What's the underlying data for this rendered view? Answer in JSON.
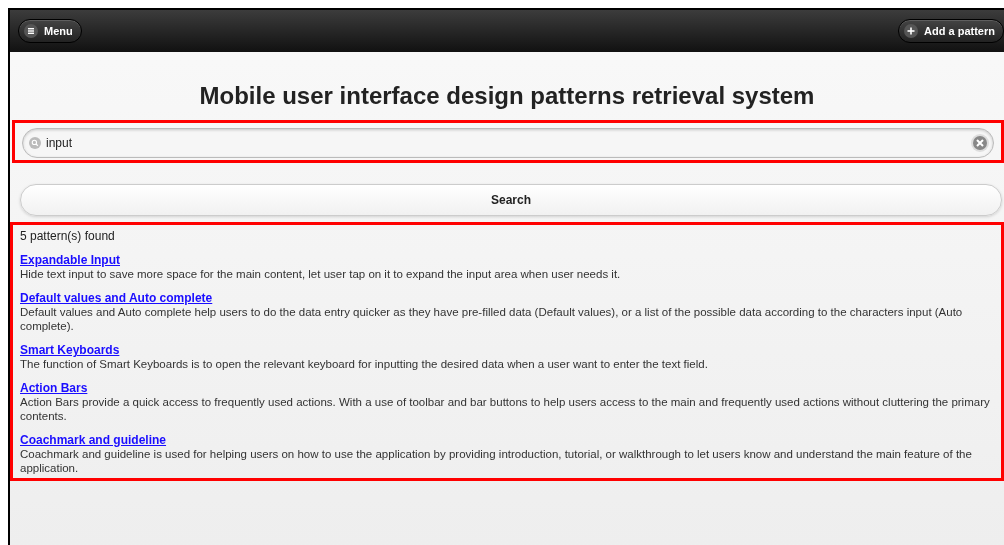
{
  "header": {
    "menu_button": "Menu",
    "add_button": "Add a pattern"
  },
  "title": "Mobile user interface design patterns retrieval system",
  "search": {
    "value": "input",
    "highlighted": true
  },
  "search_button": "Search",
  "results": {
    "highlighted": true,
    "count": "5 pattern(s) found",
    "items": [
      {
        "name": "Expandable Input",
        "description": "Hide text input to save more space for the main content, let user tap on it to expand the input area when user needs it."
      },
      {
        "name": "Default values and Auto complete",
        "description": "Default values and Auto complete help users to do the data entry quicker as they have pre-filled data (Default values), or a list of the possible data according to the characters input (Auto complete)."
      },
      {
        "name": "Smart Keyboards",
        "description": "The function of Smart Keyboards is to open the relevant keyboard for inputting the desired data when a user want to enter the text field."
      },
      {
        "name": "Action Bars",
        "description": "Action Bars provide a quick access to frequently used actions. With a use of toolbar and bar buttons to help users access to the main and frequently used actions without cluttering the primary contents."
      },
      {
        "name": "Coachmark and guideline",
        "description": "Coachmark and guideline is used for helping users on how to use the application by providing introduction, tutorial, or walkthrough to let users know and understand the main feature of the application."
      }
    ]
  }
}
